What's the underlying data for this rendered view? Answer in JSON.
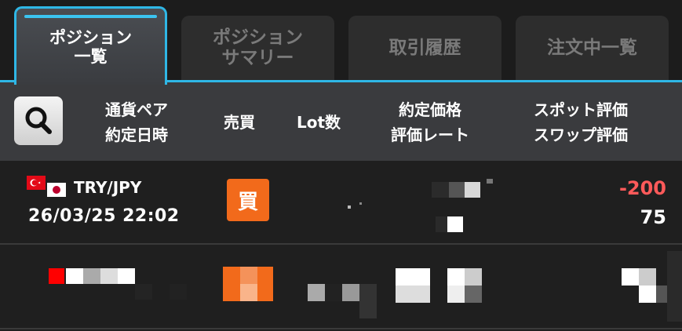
{
  "tabs": [
    {
      "label": "ポジション\n一覧",
      "active": true
    },
    {
      "label": "ポジション\nサマリー",
      "active": false
    },
    {
      "label": "取引履歴",
      "active": false
    },
    {
      "label": "注文中一覧",
      "active": false
    }
  ],
  "header": {
    "currency_pair": "通貨ペア",
    "contract_datetime": "約定日時",
    "side": "売買",
    "lot": "Lot数",
    "contract_price": "約定価格",
    "valuation_rate": "評価レート",
    "spot_valuation": "スポット評価",
    "swap_valuation": "スワップ評価"
  },
  "rows": [
    {
      "pair": "TRY/JPY",
      "datetime": "26/03/25 22:02",
      "side": "買",
      "spot_pnl": "-200",
      "swap_pnl": "75"
    }
  ],
  "colors": {
    "accent": "#2fb7e6",
    "buy": "#f26a1b",
    "negative": "#ff5a5a"
  },
  "icons": {
    "search": "magnifier-icon",
    "flag_tr": "turkey-flag-icon",
    "flag_jp": "japan-flag-icon"
  }
}
